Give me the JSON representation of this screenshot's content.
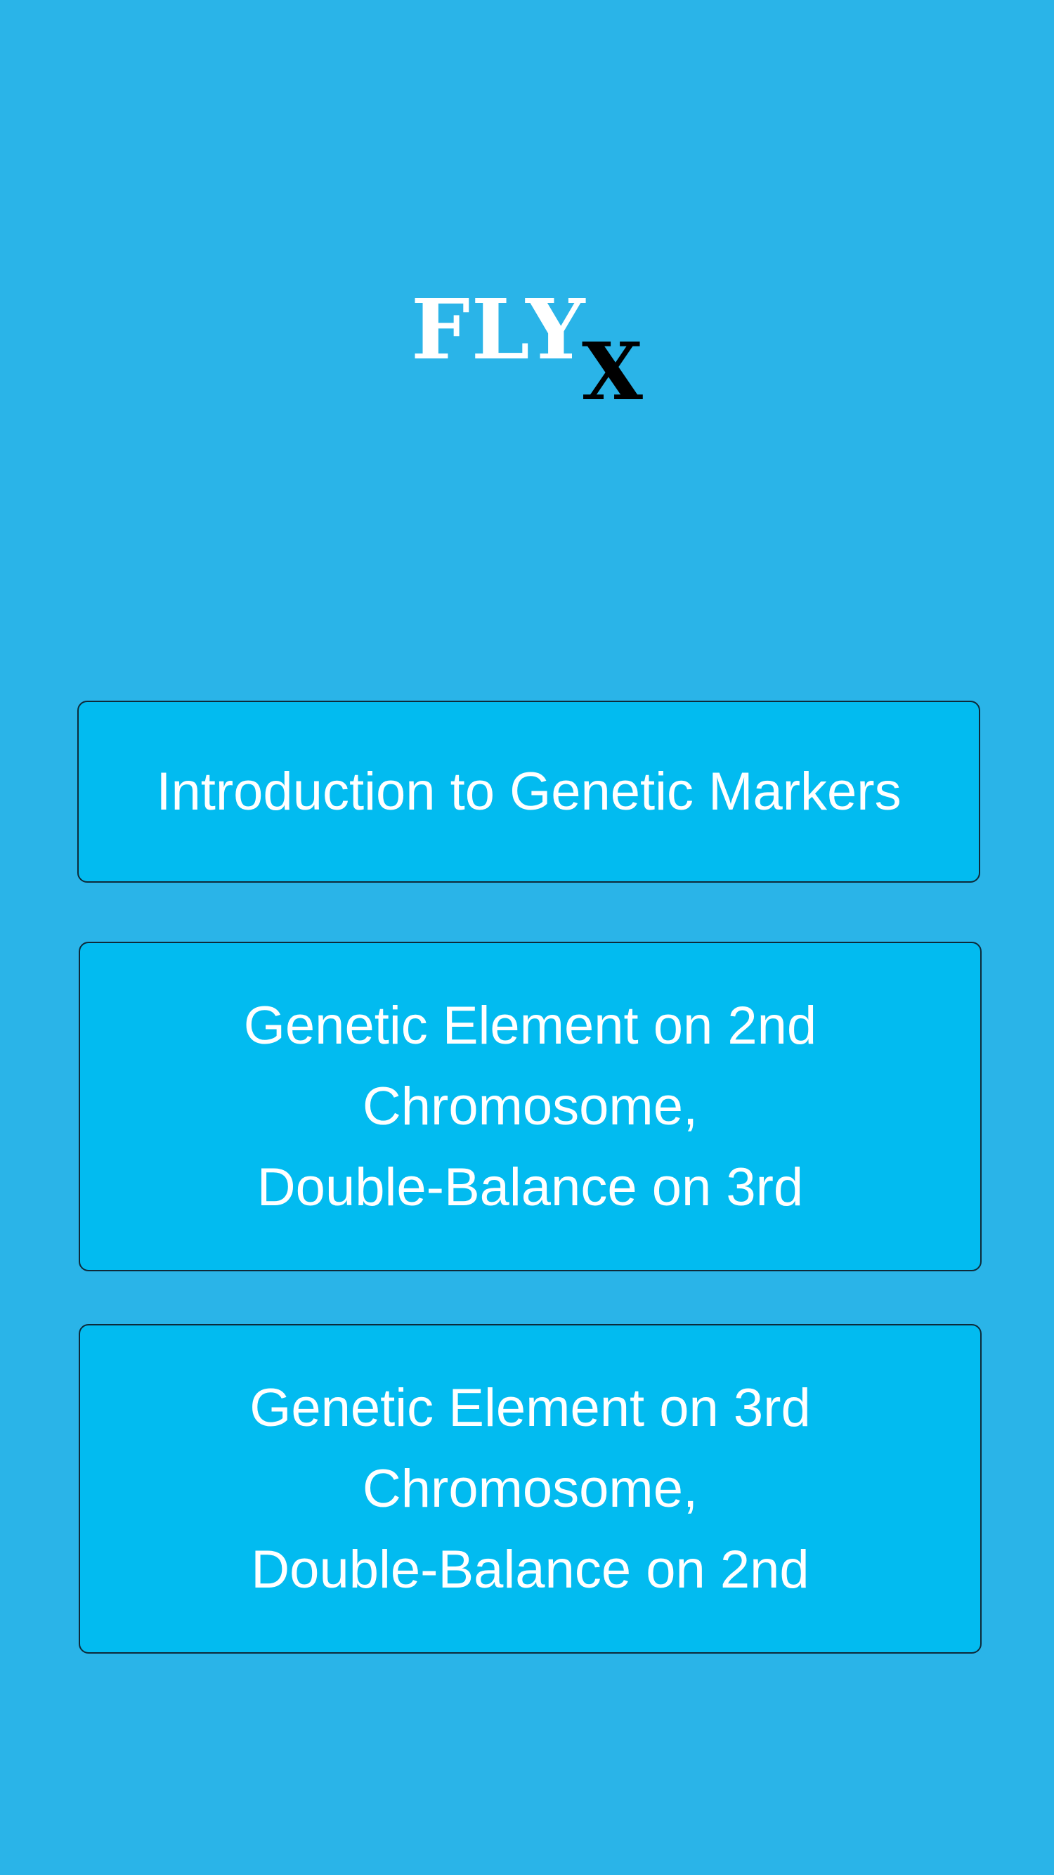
{
  "logo": {
    "main_text": "FLY",
    "subscript_text": "X"
  },
  "menu": {
    "items": [
      {
        "label": "Introduction to Genetic Markers"
      },
      {
        "label": "Genetic Element on 2nd\nChromosome,\nDouble-Balance on 3rd"
      },
      {
        "label": "Genetic Element on 3rd\nChromosome,\nDouble-Balance on 2nd"
      }
    ]
  },
  "colors": {
    "background": "#2ab4e8",
    "button_fill": "#02bbf0",
    "button_border": "#0d2a3a",
    "text": "#ffffff",
    "logo_subscript": "#000000"
  }
}
